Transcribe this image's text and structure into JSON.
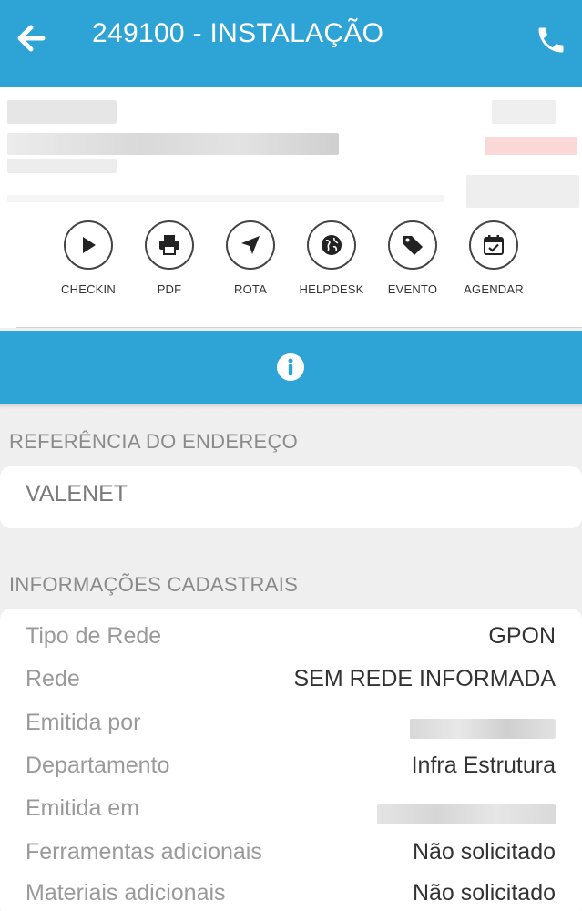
{
  "header": {
    "title": "249100 - INSTALAÇÃO",
    "back_icon": "arrow-left-icon",
    "phone_icon": "phone-icon"
  },
  "actions": [
    {
      "label": "CHECKIN",
      "icon": "play-icon"
    },
    {
      "label": "PDF",
      "icon": "printer-icon"
    },
    {
      "label": "ROTA",
      "icon": "navigation-icon"
    },
    {
      "label": "HELPDESK",
      "icon": "globe-icon"
    },
    {
      "label": "EVENTO",
      "icon": "tag-icon"
    },
    {
      "label": "AGENDAR",
      "icon": "calendar-check-icon"
    }
  ],
  "info_bar": {
    "icon": "info-icon"
  },
  "address_reference": {
    "title": "REFERÊNCIA DO ENDEREÇO",
    "value": "VALENET"
  },
  "registration": {
    "title": "INFORMAÇÕES CADASTRAIS",
    "rows": [
      {
        "label": "Tipo de Rede",
        "value": "GPON"
      },
      {
        "label": "Rede",
        "value": "SEM REDE INFORMADA"
      },
      {
        "label": "Emitida por",
        "value": ""
      },
      {
        "label": "Departamento",
        "value": "Infra Estrutura"
      },
      {
        "label": "Emitida em",
        "value": ""
      },
      {
        "label": "Ferramentas adicionais",
        "value": "Não solicitado"
      },
      {
        "label": "Materiais adicionais",
        "value": "Não solicitado"
      }
    ]
  },
  "colors": {
    "primary": "#2ea3d5",
    "background": "#efefef",
    "label": "#9a9a9a",
    "value": "#333333"
  }
}
